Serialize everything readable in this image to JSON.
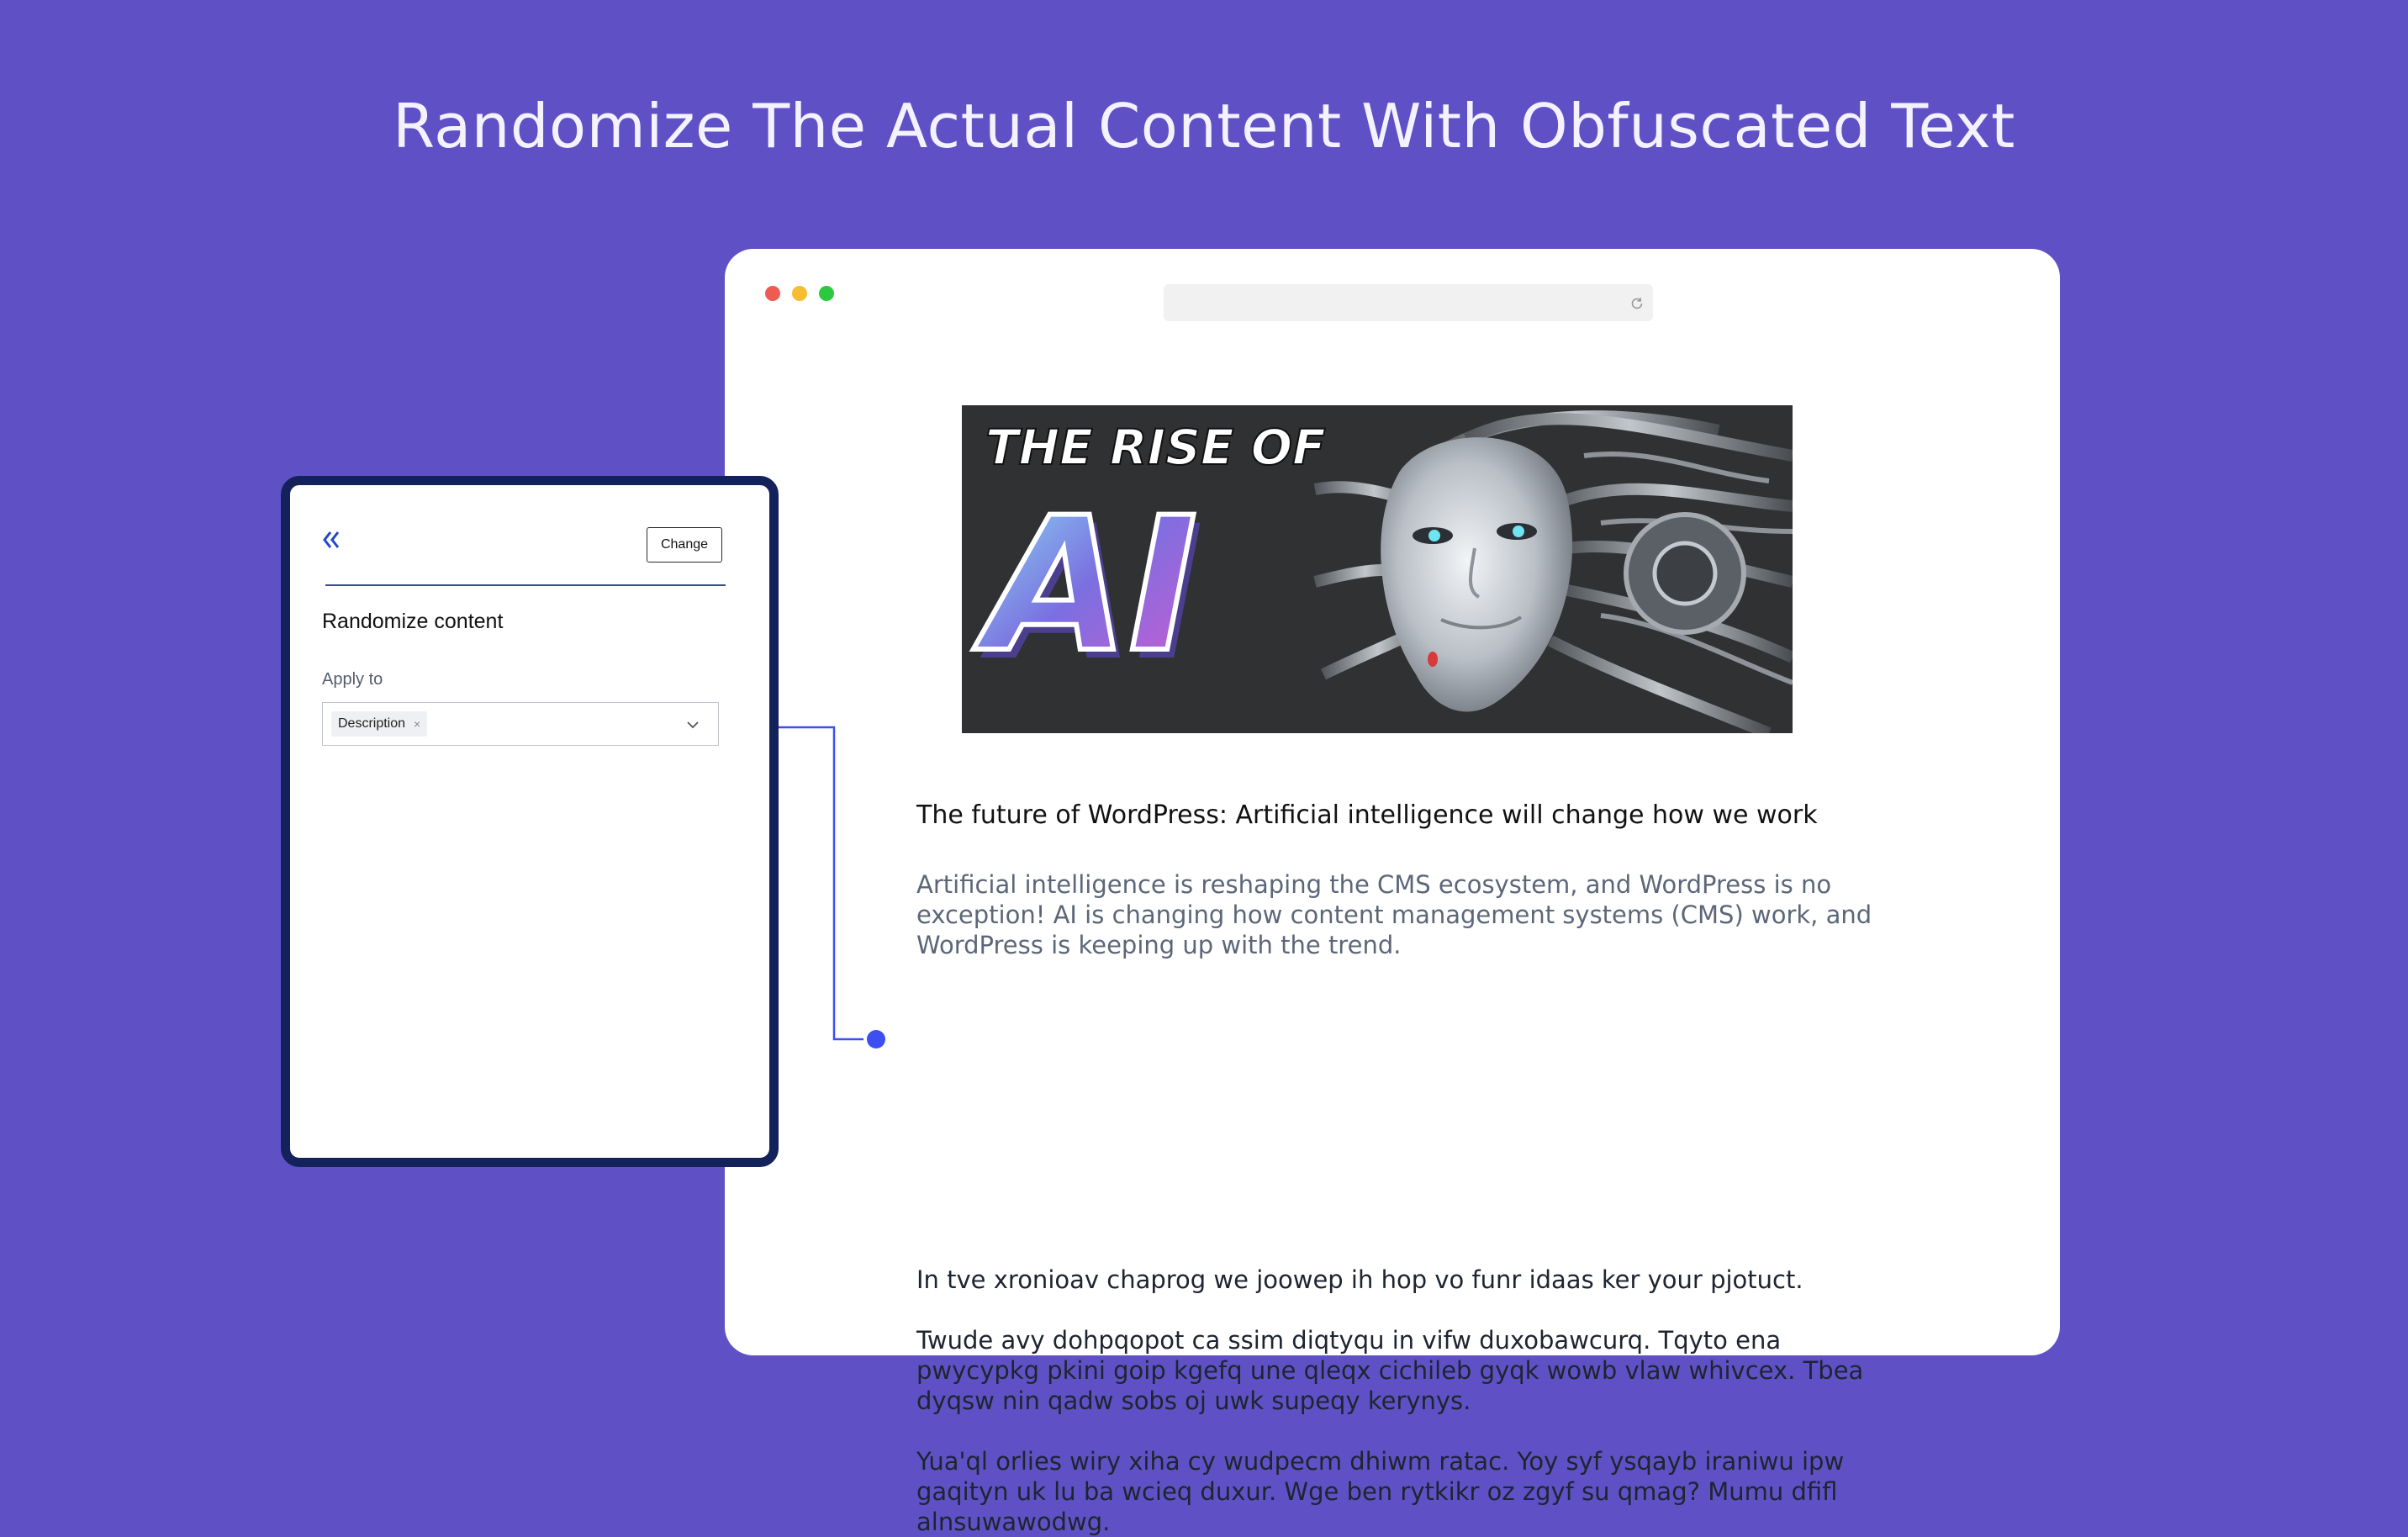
{
  "headline": "Randomize The Actual Content With Obfuscated Text",
  "colors": {
    "background": "#5f51c5",
    "panel_border": "#13225a",
    "accent": "#3d4ff0"
  },
  "panel": {
    "back_icon": "double-chevron-left-icon",
    "change_label": "Change",
    "heading": "Randomize content",
    "apply_label": "Apply to",
    "selected_tag": "Description",
    "remove_glyph": "×"
  },
  "page": {
    "hero_title_line1": "THE RISE OF",
    "hero_title_line2": "AI",
    "title": "The future of WordPress: Artificial intelligence will change how we work",
    "excerpt": "Artificial intelligence is reshaping the CMS ecosystem, and WordPress is no exception! AI is changing how content management systems (CMS) work, and WordPress is keeping up with the trend.",
    "paragraphs": [
      "In tve xronioav chaprog we joowep ih hop vo funr idaas ker your pjotuct.",
      "Twude avy dohpqopot ca ssim diqtyqu in vifw duxobawcurq. Tqyto ena pwycypkg pkini goip kgefq une qleqx cichileb gyqk wowb vlaw whivcex. Tbea dyqsw nin qadw sobs oj uwk supeqy kerynys.",
      "Yua'ql orlies wiry xiha cy wudpecm dhiwm ratac. Yoy syf ysqayb iraniwu ipw gaqityn uk lu ba wcieq duxur. Wge ben rytkikr oz zgyf su qmag? Mumu dfifl alnsuwawodwg."
    ]
  }
}
